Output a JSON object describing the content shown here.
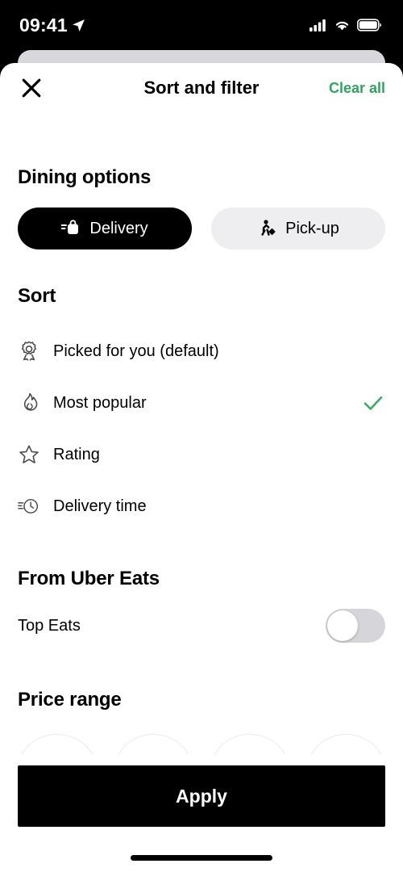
{
  "status_bar": {
    "time": "09:41",
    "location_icon": "location-arrow-icon",
    "signal_icon": "cellular-signal-icon",
    "wifi_icon": "wifi-icon",
    "battery_icon": "battery-full-icon"
  },
  "header": {
    "close_icon": "close-icon",
    "title": "Sort and filter",
    "clear_all_label": "Clear all",
    "clear_all_color": "#2fa360"
  },
  "dining_options": {
    "title": "Dining options",
    "options": [
      {
        "label": "Delivery",
        "icon": "delivery-bag-icon",
        "selected": true
      },
      {
        "label": "Pick-up",
        "icon": "walking-person-icon",
        "selected": false
      }
    ]
  },
  "sort": {
    "title": "Sort",
    "options": [
      {
        "label": "Picked for you (default)",
        "icon": "award-ribbon-icon",
        "selected": false
      },
      {
        "label": "Most popular",
        "icon": "flame-icon",
        "selected": true
      },
      {
        "label": "Rating",
        "icon": "star-icon",
        "selected": false
      },
      {
        "label": "Delivery time",
        "icon": "clock-speed-icon",
        "selected": false
      }
    ],
    "check_icon": "checkmark-icon",
    "check_color": "#3cab63"
  },
  "from_uber_eats": {
    "title": "From Uber Eats",
    "rows": [
      {
        "label": "Top Eats",
        "toggle_on": false
      }
    ]
  },
  "price_range": {
    "title": "Price range",
    "options": [
      {
        "label": "$",
        "selected": false
      },
      {
        "label": "$$",
        "selected": false
      },
      {
        "label": "$$$",
        "selected": false
      },
      {
        "label": "$$$$",
        "selected": false
      }
    ]
  },
  "footer": {
    "apply_label": "Apply"
  }
}
